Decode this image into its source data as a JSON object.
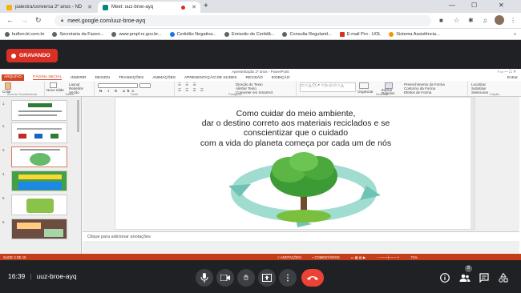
{
  "browser": {
    "tabs": [
      {
        "label": "palestra/conversa 2º anos - ND",
        "active": false
      },
      {
        "label": "Meet: uuz-broe-ayq",
        "active": true
      }
    ],
    "url": "meet.google.com/uuz-broe-ayq",
    "bookmarks": [
      "bufton.bt.com.br",
      "Secretaria da Fazen...",
      "www.pmpf.rs.gov.br...",
      "Certidão Negativa...",
      "Emissão de Certidã...",
      "Consulta Regularid...",
      "E-mail Pro - UOL",
      "Sistema Assistência..."
    ]
  },
  "meet": {
    "recording_label": "GRAVANDO",
    "time": "16:39",
    "meeting_code": "uuz-broe-ayq",
    "participants_count": "8"
  },
  "powerpoint": {
    "title": "Apresentação 2º anos - PowerPoint",
    "file_tab": "ARQUIVO",
    "tabs": [
      "PÁGINA INICIAL",
      "INSERIR",
      "DESIGN",
      "TRANSIÇÕES",
      "ANIMAÇÕES",
      "APRESENTAÇÃO DE SLIDES",
      "REVISÃO",
      "EXIBIÇÃO"
    ],
    "user": "Entrar",
    "ribbon": {
      "paste": "Colar",
      "new_slide": "Novo Slide",
      "layout": "Layout",
      "reset": "Redefinir",
      "section": "Seção",
      "arrange": "Organizar",
      "quick_styles": "Estilos Rápidos",
      "find": "Localizar",
      "replace": "Substituir",
      "select": "Selecionar",
      "text_direction": "Direção do Texto",
      "align_text": "Alinhar Texto",
      "convert_smartart": "Converter em SmartArt",
      "shape_fill": "Preenchimento da Forma",
      "shape_outline": "Contorno da Forma",
      "shape_effects": "Efeitos de Forma",
      "groups": [
        "Área de Transferência",
        "Slides",
        "Fonte",
        "Parágrafo",
        "Desenho",
        "Edição"
      ]
    },
    "slide_numbers": [
      "1",
      "2",
      "3",
      "4",
      "5",
      "6"
    ],
    "slide_text": [
      "Como cuidar do meio ambiente,",
      "dar o destino correto aos materiais reciclados e se",
      "conscientizar que o cuidado",
      "com a vida do planeta começa por cada um de nós"
    ],
    "notes_placeholder": "Clique para adicionar anotações",
    "status": {
      "slide": "SLIDE 3 DE 15",
      "notes": "ANOTAÇÕES",
      "comments": "COMENTÁRIOS",
      "zoom": "71%"
    }
  },
  "colors": {
    "recording": "#d93025",
    "end_call": "#ea4335",
    "ppt_accent": "#c43e1c"
  }
}
